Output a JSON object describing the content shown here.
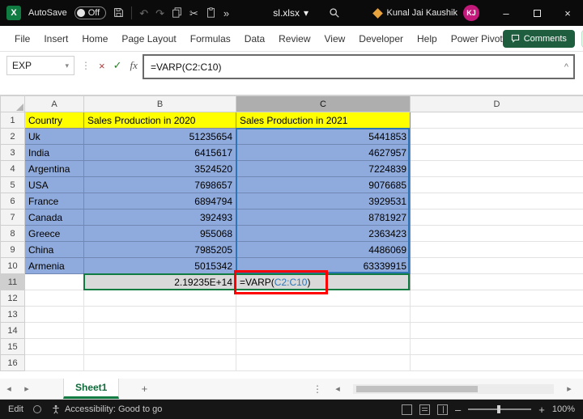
{
  "titlebar": {
    "autosave_label": "AutoSave",
    "autosave_state": "Off",
    "filename": "sl.xlsx",
    "user_name": "Kunal Jai Kaushik",
    "user_initials": "KJ"
  },
  "menubar": {
    "items": [
      "File",
      "Insert",
      "Home",
      "Page Layout",
      "Formulas",
      "Data",
      "Review",
      "View",
      "Developer",
      "Help",
      "Power Pivot"
    ],
    "comments_label": "Comments"
  },
  "formula_bar": {
    "name_box_value": "EXP",
    "formula": "=VARP(C2:C10)"
  },
  "grid": {
    "column_headers": [
      "A",
      "B",
      "C",
      "D"
    ],
    "row_headers": [
      "1",
      "2",
      "3",
      "4",
      "5",
      "6",
      "7",
      "8",
      "9",
      "10",
      "11",
      "12",
      "13",
      "14",
      "15",
      "16"
    ],
    "header_row": {
      "country": "Country",
      "sales_2020": "Sales Production in 2020",
      "sales_2021": "Sales Production in 2021"
    },
    "rows": [
      {
        "country": "Uk",
        "sales_2020": "51235654",
        "sales_2021": "5441853"
      },
      {
        "country": "India",
        "sales_2020": "6415617",
        "sales_2021": "4627957"
      },
      {
        "country": "Argentina",
        "sales_2020": "3524520",
        "sales_2021": "7224839"
      },
      {
        "country": "USA",
        "sales_2020": "7698657",
        "sales_2021": "9076685"
      },
      {
        "country": "France",
        "sales_2020": "6894794",
        "sales_2021": "3929531"
      },
      {
        "country": "Canada",
        "sales_2020": "392493",
        "sales_2021": "8781927"
      },
      {
        "country": "Greece",
        "sales_2020": "955068",
        "sales_2021": "2363423"
      },
      {
        "country": "China",
        "sales_2020": "7985205",
        "sales_2021": "4486069"
      },
      {
        "country": "Armenia",
        "sales_2020": "5015342",
        "sales_2021": "63339915"
      }
    ],
    "result_row": {
      "b_value": "2.19235E+14",
      "c_formula_prefix": "=VARP(",
      "c_formula_ref": "C2:C10",
      "c_formula_suffix": ")"
    }
  },
  "sheet_bar": {
    "active_tab": "Sheet1"
  },
  "status_bar": {
    "mode": "Edit",
    "accessibility_text": "Accessibility: Good to go",
    "zoom_level": "100%"
  },
  "colors": {
    "header_fill": "#FFFF00",
    "data_fill": "#8FAADC",
    "result_fill": "#D9D9D9",
    "annotation_red": "#FF0000",
    "reference_blue": "#2E75B6",
    "excel_green": "#107C41",
    "avatar_pink": "#C2197B"
  },
  "icons": {
    "logo": "X",
    "undo": "↶",
    "redo": "↷",
    "cut": "✂",
    "more": "»",
    "dropdown": "▾",
    "minimize": "–",
    "close": "×",
    "kebab": "⋮",
    "cancel": "×",
    "enter": "✓",
    "fx": "fx",
    "collapse": "^",
    "nav_left": "◂",
    "nav_right": "▸",
    "add": "+",
    "zoom_out": "–",
    "zoom_in": "+"
  }
}
